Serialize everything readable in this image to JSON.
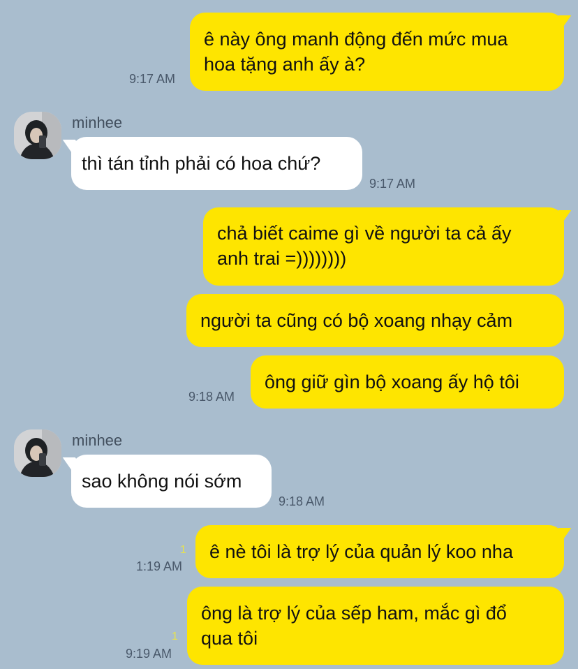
{
  "colors": {
    "background": "#a9bdce",
    "outgoing": "#fee500",
    "incoming": "#ffffff"
  },
  "messages": [
    {
      "side": "out",
      "lines": [
        "ê này ông manh động đến mức mua",
        "hoa tặng anh ấy à?"
      ],
      "time": "9:17 AM"
    },
    {
      "side": "in",
      "sender": "minhee",
      "lines": [
        "thì tán tỉnh phải có hoa chứ?"
      ],
      "time": "9:17 AM"
    },
    {
      "side": "out",
      "lines": [
        "chả biết caime gì về người ta cả ấy",
        "anh trai =))))))))"
      ]
    },
    {
      "side": "out",
      "lines": [
        "người ta cũng có bộ xoang nhạy cảm"
      ]
    },
    {
      "side": "out",
      "lines": [
        "ông giữ gìn bộ xoang ấy hộ tôi"
      ],
      "time": "9:18 AM"
    },
    {
      "side": "in",
      "sender": "minhee",
      "lines": [
        "sao không nói sớm"
      ],
      "time": "9:18 AM"
    },
    {
      "side": "out",
      "lines": [
        "ê nè tôi là trợ lý của quản lý koo nha"
      ],
      "time": "1:19 AM",
      "unread": "1"
    },
    {
      "side": "out",
      "lines": [
        "ông là trợ lý của sếp ham, mắc gì đổ",
        "qua tôi"
      ],
      "time": "9:19 AM",
      "unread": "1"
    }
  ]
}
